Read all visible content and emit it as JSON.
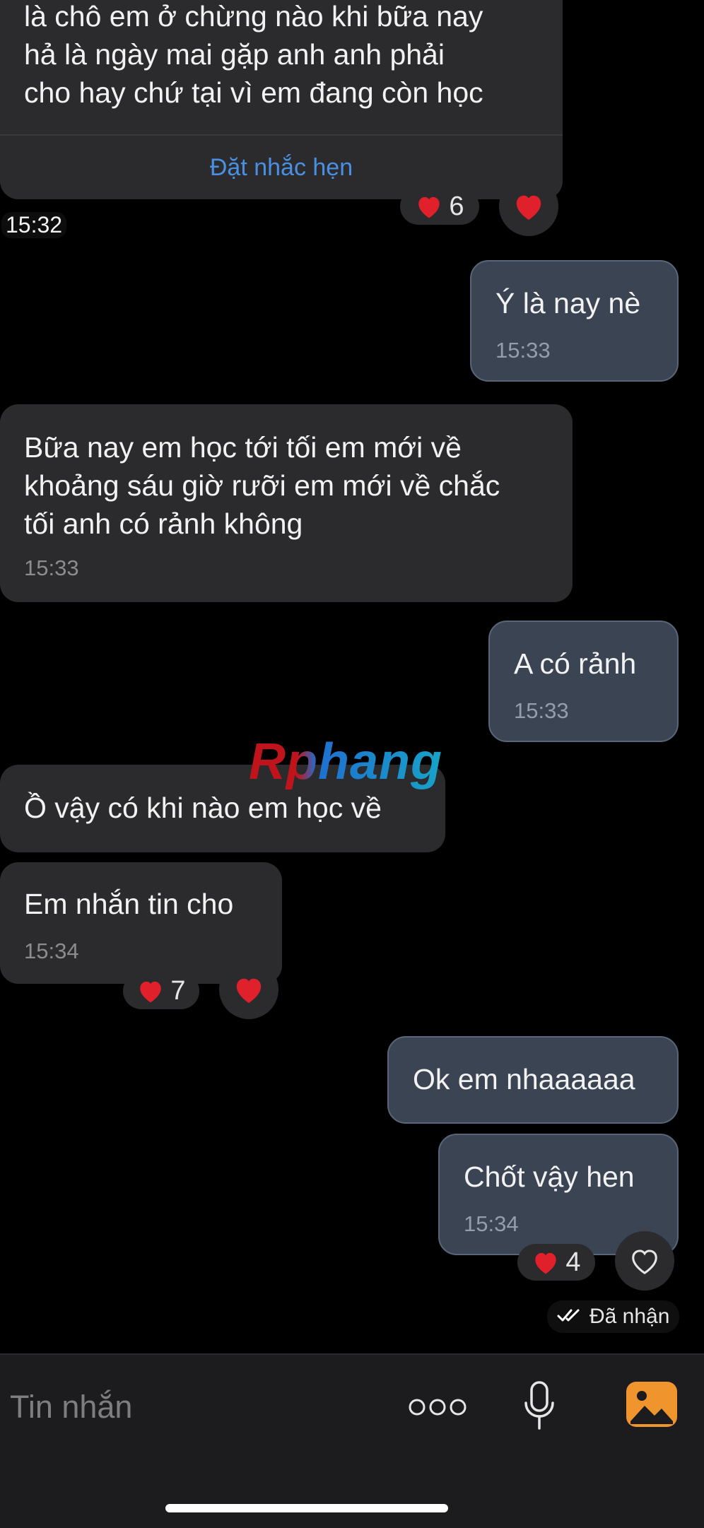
{
  "messages": [
    {
      "dir": "in",
      "text": "là chô em ở chừng nào khi bữa nay\nhả là ngày mai gặp anh anh phải\ncho hay chứ tại vì em đang còn học",
      "reminder": "Đặt nhắc hẹn",
      "reaction_count": "6"
    },
    {
      "standalone_time": "15:32"
    },
    {
      "dir": "out",
      "text": "Ý là nay nè",
      "time": "15:33"
    },
    {
      "dir": "in",
      "text": "Bữa nay em học tới tối em mới về\nkhoảng sáu giờ rưỡi em mới về chắc\ntối anh có rảnh không",
      "time": "15:33"
    },
    {
      "dir": "out",
      "text": "A có rảnh",
      "time": "15:33"
    },
    {
      "dir": "in",
      "text": "Ồ vậy có khi nào em học về"
    },
    {
      "dir": "in",
      "text": "Em nhắn tin cho",
      "time": "15:34",
      "reaction_count": "7"
    },
    {
      "dir": "out",
      "text": "Ok em nhaaaaaa"
    },
    {
      "dir": "out",
      "text": "Chốt vậy hen",
      "time": "15:34",
      "reaction_count": "4"
    }
  ],
  "status": {
    "label": "Đã nhận"
  },
  "composer": {
    "placeholder": "Tin nhắn"
  },
  "watermark": {
    "text": "Rphang"
  },
  "colors": {
    "accent_link": "#4a90e2",
    "in_bubble": "#2b2b2d",
    "out_bubble": "#3b4453",
    "heart": "#e0202a",
    "image_button": "#f0952d"
  }
}
